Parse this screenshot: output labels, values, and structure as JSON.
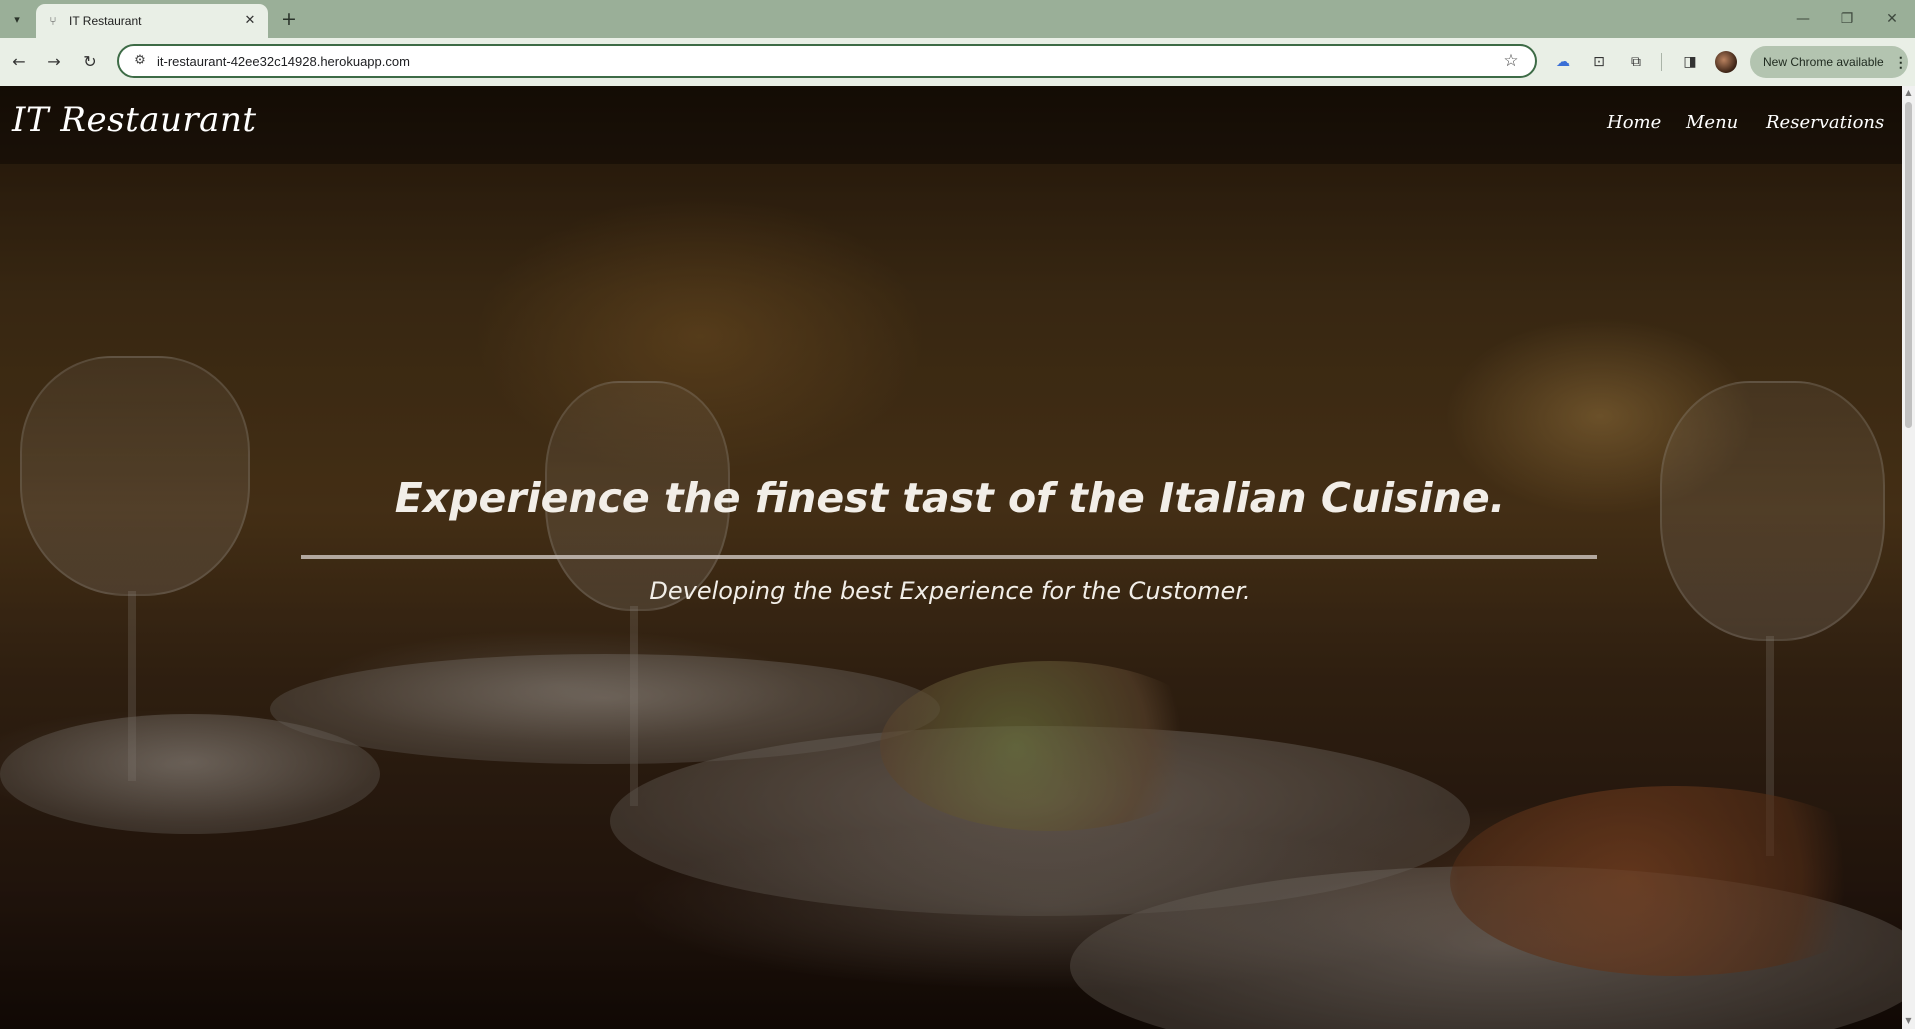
{
  "browser": {
    "tab": {
      "title": "IT Restaurant",
      "favicon": "restaurant-icon"
    },
    "address": {
      "url": "it-restaurant-42ee32c14928.herokuapp.com"
    },
    "update_button": {
      "label": "New Chrome available"
    }
  },
  "site": {
    "brand": "IT Restaurant",
    "nav": [
      {
        "label": "Home"
      },
      {
        "label": "Menu"
      },
      {
        "label": "Reservations"
      }
    ],
    "hero": {
      "title": "Experience the finest tast of the Italian Cuisine.",
      "subtitle": "Developing the best Experience for the Customer."
    }
  }
}
